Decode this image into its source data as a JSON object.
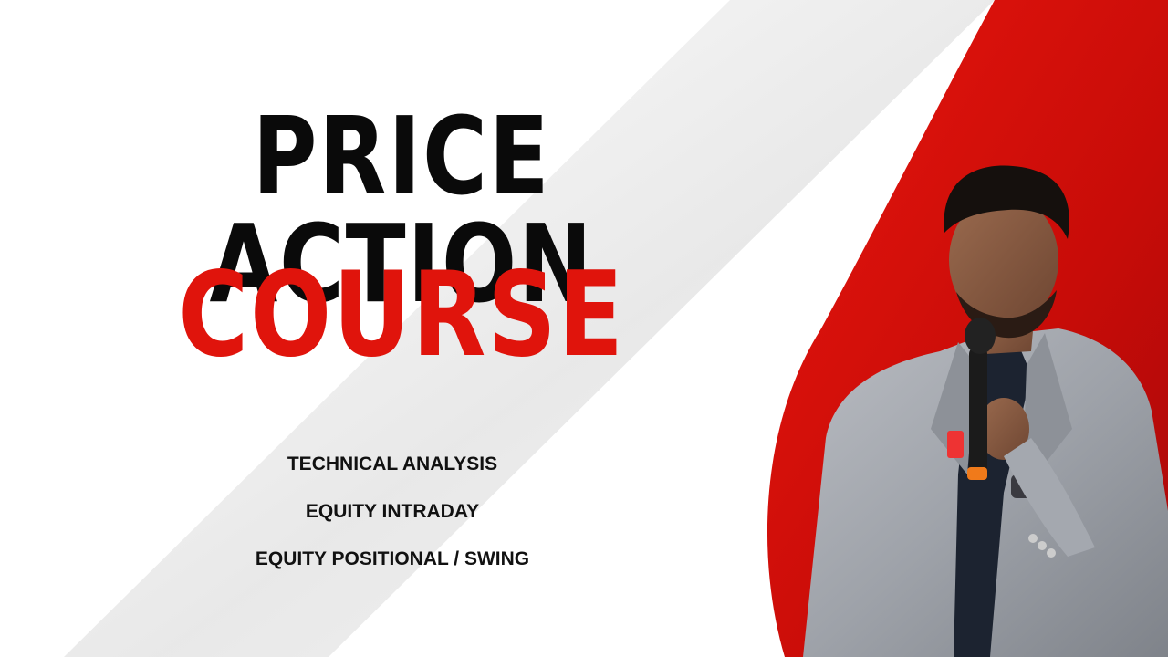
{
  "headline": {
    "line1": "PRICE ACTION",
    "line2": "COURSE"
  },
  "topics": [
    "TECHNICAL ANALYSIS",
    "EQUITY INTRADAY",
    "EQUITY POSITIONAL / SWING"
  ],
  "colors": {
    "accent_red": "#e0140c",
    "headline_black": "#0a0a0a",
    "panel_red": "#d40f0a"
  },
  "photo": {
    "subject": "speaker-with-microphone"
  }
}
